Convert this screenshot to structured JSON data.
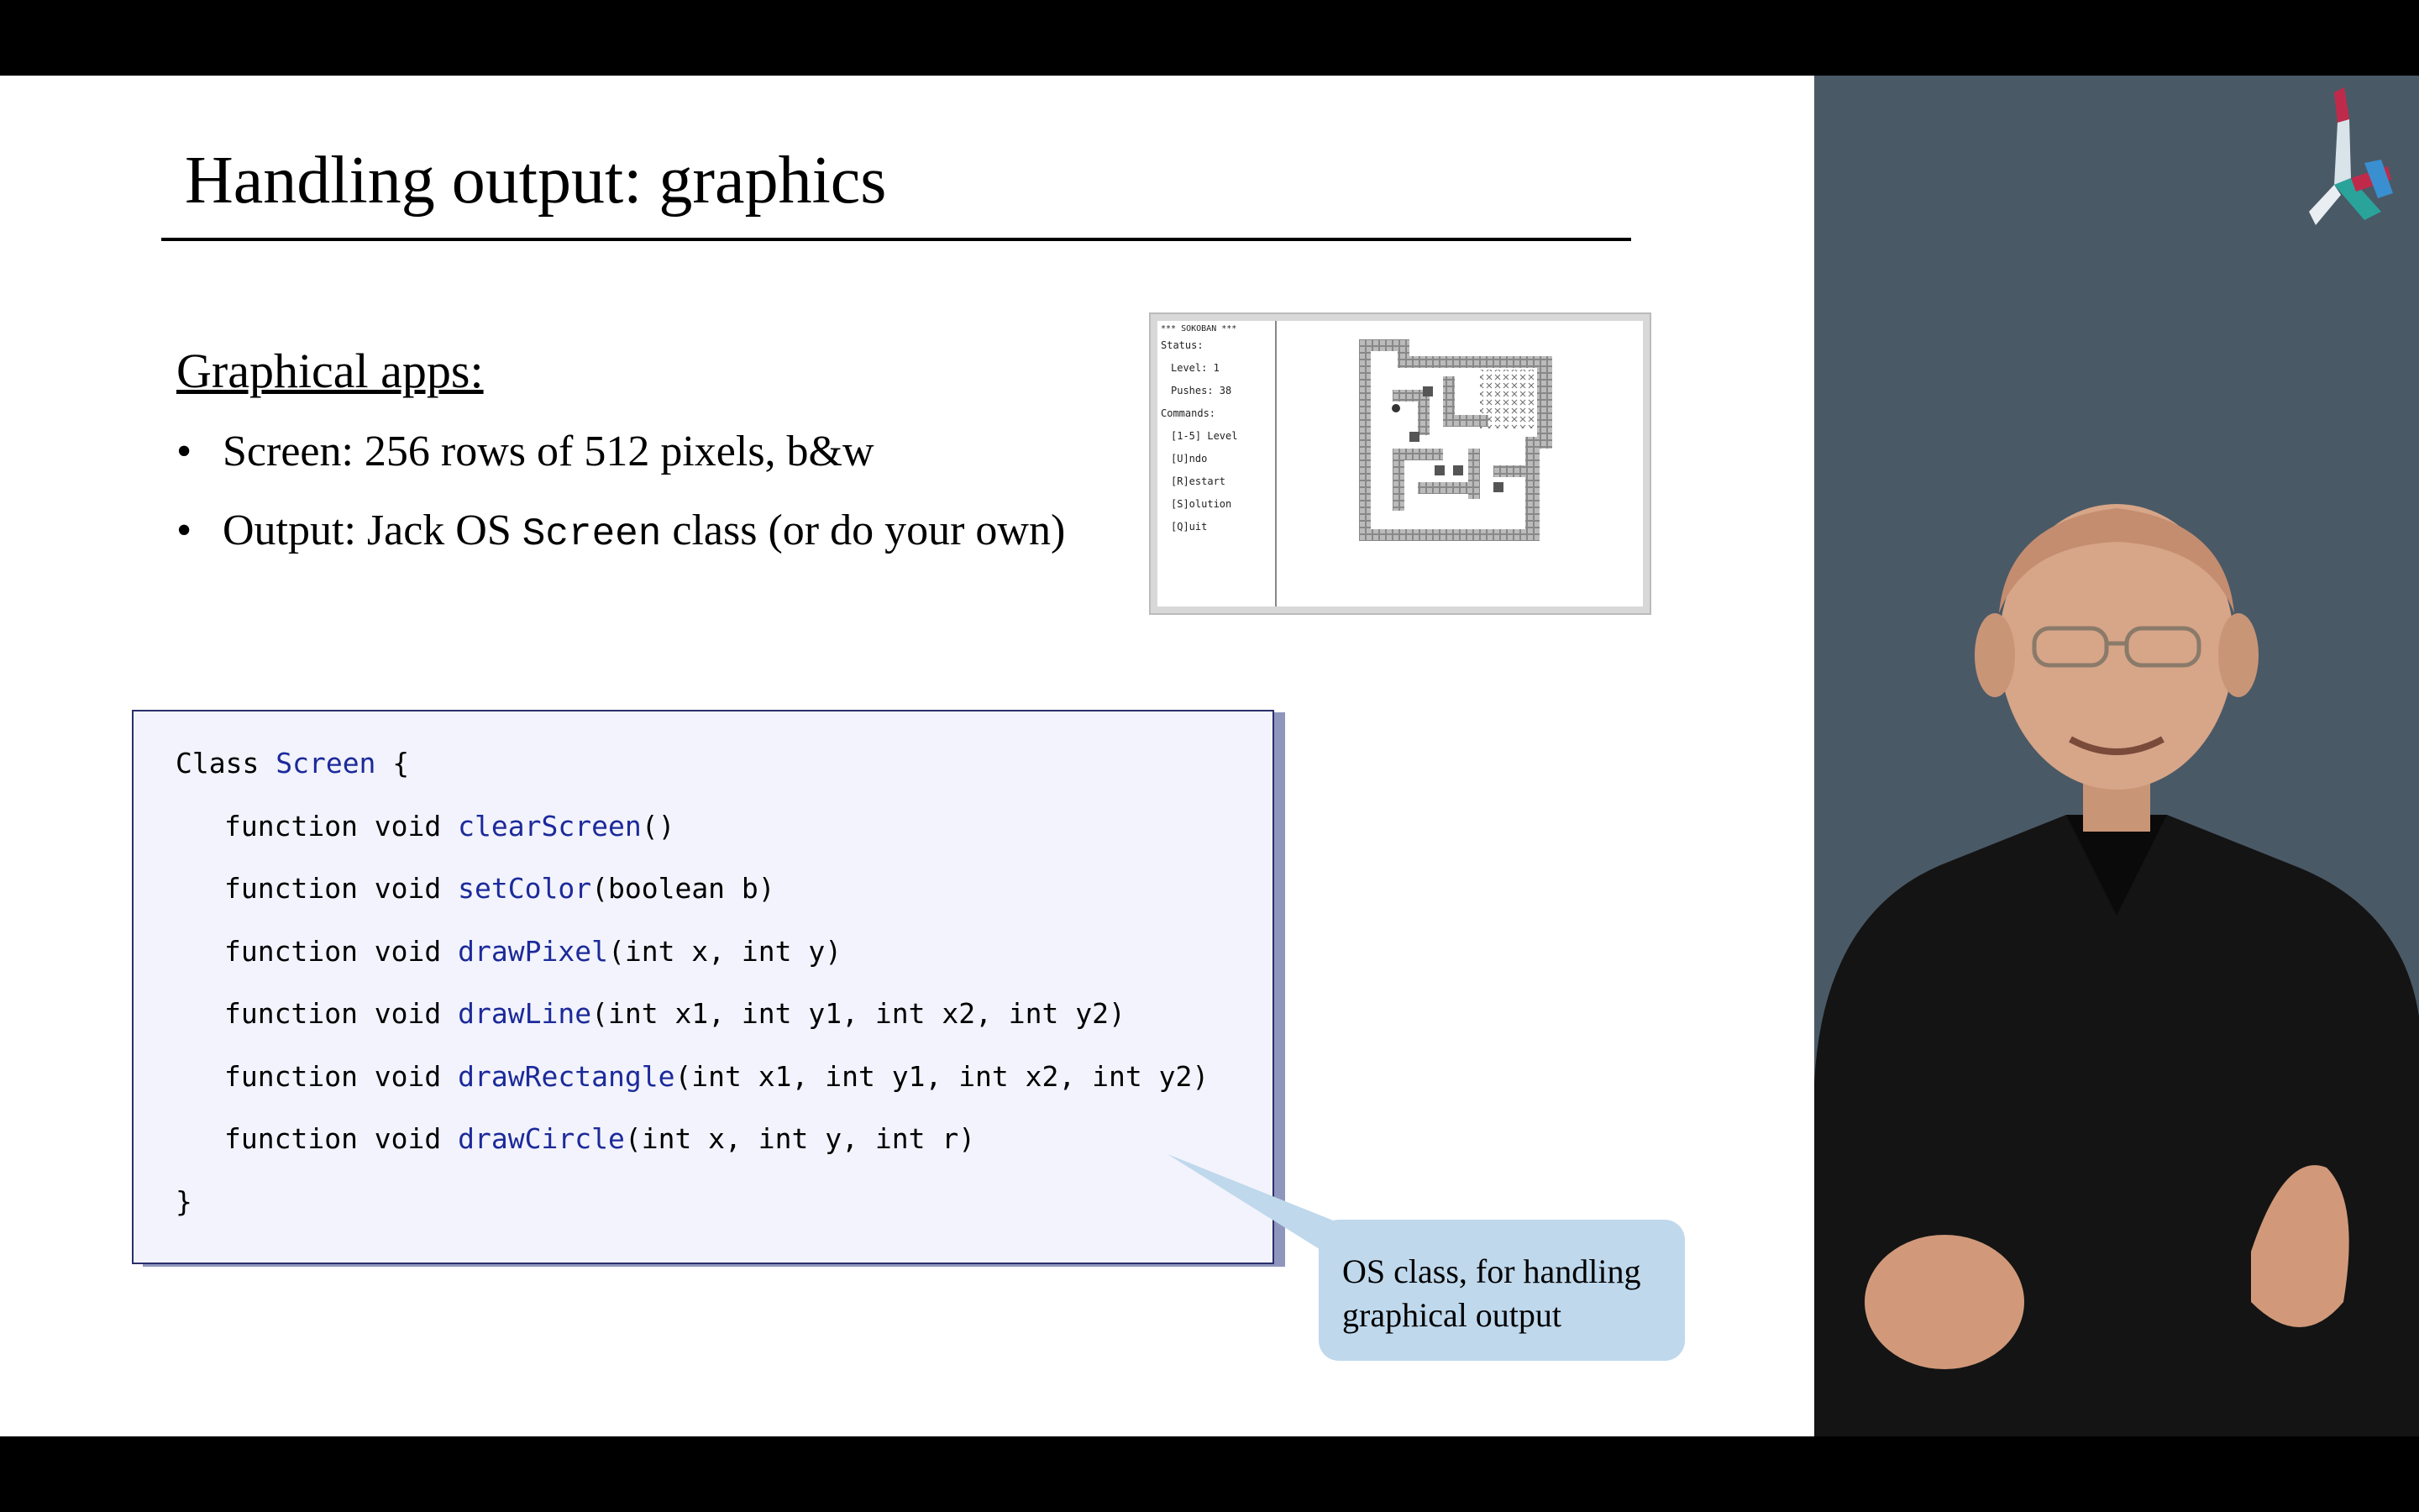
{
  "slide": {
    "title": "Handling output: graphics",
    "subheading": "Graphical apps:",
    "bullets": [
      {
        "text": "Screen: 256 rows of 512 pixels, b&w"
      },
      {
        "prefix": "Output: Jack OS ",
        "code": "Screen",
        "suffix": " class (or do your own)"
      }
    ]
  },
  "game_screenshot": {
    "header_line": "*** SOKOBAN ***",
    "lines": [
      "Status:",
      "  Level:  1",
      "  Pushes: 38",
      "Commands:",
      "  [1-5] Level",
      "  [U]ndo",
      "  [R]estart",
      "  [S]olution",
      "  [Q]uit"
    ]
  },
  "code": {
    "line0": {
      "keyword": "Class ",
      "name": "Screen",
      "rest": " {"
    },
    "functions": [
      {
        "prefix": "function void ",
        "name": "clearScreen",
        "args": "()"
      },
      {
        "prefix": "function void ",
        "name": "setColor",
        "args": "(boolean b)"
      },
      {
        "prefix": "function void ",
        "name": "drawPixel",
        "args": "(int x, int y)"
      },
      {
        "prefix": "function void ",
        "name": "drawLine",
        "args": "(int x1, int y1, int x2, int y2)"
      },
      {
        "prefix": "function void ",
        "name": "drawRectangle",
        "args": "(int x1, int y1, int x2, int y2)"
      },
      {
        "prefix": "function void ",
        "name": "drawCircle",
        "args": "(int x, int y, int r)"
      }
    ],
    "closing": "}"
  },
  "callout": {
    "line1": "OS class, for handling",
    "line2": "graphical output"
  },
  "colors": {
    "function_name": "#1c2a9a",
    "code_background": "#f2f3fc",
    "callout_background": "#bfd8ec",
    "side_panel": "#4a5966"
  },
  "icons": [
    "course-logo-icon",
    "presenter-video"
  ]
}
